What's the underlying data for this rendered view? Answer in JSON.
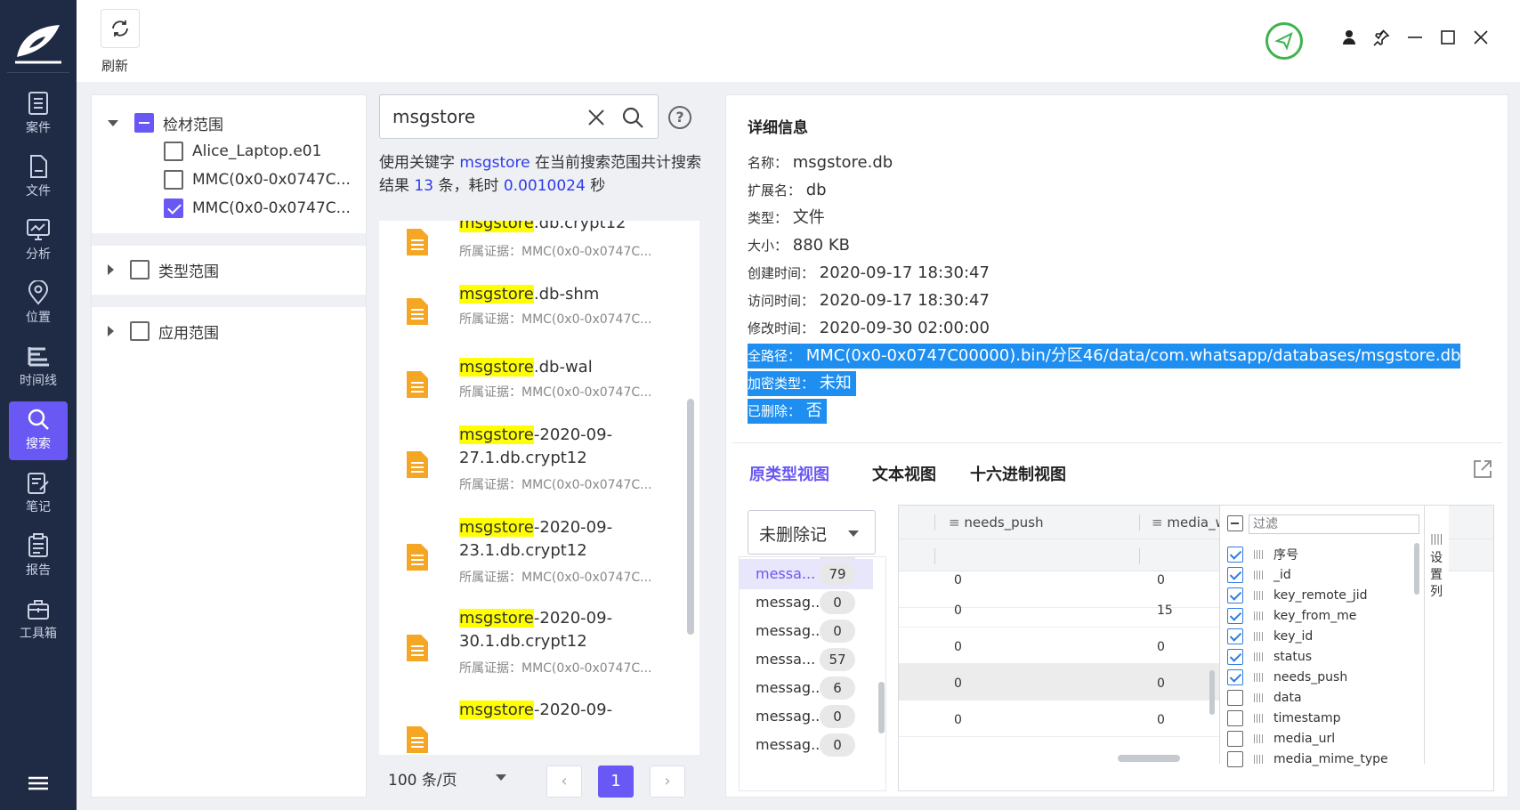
{
  "sidebar": {
    "items": [
      {
        "label": "案件",
        "icon": "case-icon"
      },
      {
        "label": "文件",
        "icon": "file-icon"
      },
      {
        "label": "分析",
        "icon": "analysis-icon"
      },
      {
        "label": "位置",
        "icon": "location-icon"
      },
      {
        "label": "时间线",
        "icon": "timeline-icon"
      },
      {
        "label": "搜索",
        "icon": "search-icon",
        "active": true
      },
      {
        "label": "笔记",
        "icon": "notes-icon"
      },
      {
        "label": "报告",
        "icon": "report-icon"
      },
      {
        "label": "工具箱",
        "icon": "toolbox-icon"
      }
    ]
  },
  "toolbar": {
    "refresh_label": "刷新"
  },
  "scope": {
    "evidence": {
      "label": "检材范围",
      "items": [
        "Alice_Laptop.e01",
        "MMC(0x0-0x0747C...",
        "MMC(0x0-0x0747C..."
      ]
    },
    "type": {
      "label": "类型范围"
    },
    "app": {
      "label": "应用范围"
    }
  },
  "search": {
    "query": "msgstore",
    "summary_prefix": "使用关键字 ",
    "summary_keyword": "msgstore",
    "summary_mid": " 在当前搜索范围共计搜索结果 ",
    "summary_count": "13",
    "summary_mid2": " 条，耗时 ",
    "summary_time": "0.0010024",
    "summary_suffix": " 秒"
  },
  "results": [
    {
      "kw": "msgstore",
      "rest": ".db.crypt12",
      "evidence": "所属证据：MMC(0x0-0x0747C..."
    },
    {
      "kw": "msgstore",
      "rest": ".db-shm",
      "evidence": "所属证据：MMC(0x0-0x0747C..."
    },
    {
      "kw": "msgstore",
      "rest": ".db-wal",
      "evidence": "所属证据：MMC(0x0-0x0747C..."
    },
    {
      "kw": "msgstore",
      "rest": "-2020-09-27.1.db.crypt12",
      "evidence": "所属证据：MMC(0x0-0x0747C..."
    },
    {
      "kw": "msgstore",
      "rest": "-2020-09-23.1.db.crypt12",
      "evidence": "所属证据：MMC(0x0-0x0747C..."
    },
    {
      "kw": "msgstore",
      "rest": "-2020-09-30.1.db.crypt12",
      "evidence": "所属证据：MMC(0x0-0x0747C..."
    },
    {
      "kw": "msgstore",
      "rest": "-2020-09-",
      "evidence": ""
    }
  ],
  "pager": {
    "page_size": "100 条/页",
    "current": "1",
    "prev": "‹",
    "next": "›"
  },
  "detail": {
    "title": "详细信息",
    "rows": [
      {
        "label": "名称：",
        "value": "msgstore.db"
      },
      {
        "label": "扩展名：",
        "value": "db"
      },
      {
        "label": "类型：",
        "value": "文件"
      },
      {
        "label": "大小：",
        "value": "880 KB"
      },
      {
        "label": "创建时间：",
        "value": "2020-09-17 18:30:47"
      },
      {
        "label": "访问时间：",
        "value": "2020-09-17 18:30:47"
      },
      {
        "label": "修改时间：",
        "value": "2020-09-30 02:00:00"
      },
      {
        "label": "全路径：",
        "value": "MMC(0x0-0x0747C00000).bin/分区46/data/com.whatsapp/databases/msgstore.db",
        "selected": true
      },
      {
        "label": "加密类型：",
        "value": "未知",
        "selected": true
      },
      {
        "label": "已删除：",
        "value": "否",
        "selected": true
      }
    ]
  },
  "view_tabs": [
    "原类型视图",
    "文本视图",
    "十六进制视图"
  ],
  "db_view": {
    "filter_select": "未删除记",
    "tables": [
      {
        "name": "messa...",
        "count": "79",
        "active": true
      },
      {
        "name": "messag...",
        "count": "0"
      },
      {
        "name": "messag...",
        "count": "0"
      },
      {
        "name": "messa...",
        "count": "57"
      },
      {
        "name": "messag...",
        "count": "6"
      },
      {
        "name": "messag...",
        "count": "0"
      },
      {
        "name": "messag...",
        "count": "0"
      }
    ],
    "columns": [
      "needs_push",
      "media_w"
    ],
    "rows": [
      [
        "0",
        "0"
      ],
      [
        "0",
        "15"
      ],
      [
        "0",
        "0"
      ],
      [
        "0",
        "0"
      ],
      [
        "0",
        "0"
      ]
    ],
    "col_filter_placeholder": "过滤",
    "col_list": [
      {
        "name": "序号",
        "checked": true
      },
      {
        "name": "_id",
        "checked": true
      },
      {
        "name": "key_remote_jid",
        "checked": true
      },
      {
        "name": "key_from_me",
        "checked": true
      },
      {
        "name": "key_id",
        "checked": true
      },
      {
        "name": "status",
        "checked": true
      },
      {
        "name": "needs_push",
        "checked": true
      },
      {
        "name": "data",
        "checked": false
      },
      {
        "name": "timestamp",
        "checked": false
      },
      {
        "name": "media_url",
        "checked": false
      },
      {
        "name": "media_mime_type",
        "checked": false
      }
    ],
    "side_tab": "设置列"
  },
  "colors": {
    "accent": "#6a58f4",
    "sidebar_bg": "#1f2a44",
    "highlight": "#ffff00",
    "selection": "#1e8ef0",
    "status_green": "#3fb34f"
  }
}
